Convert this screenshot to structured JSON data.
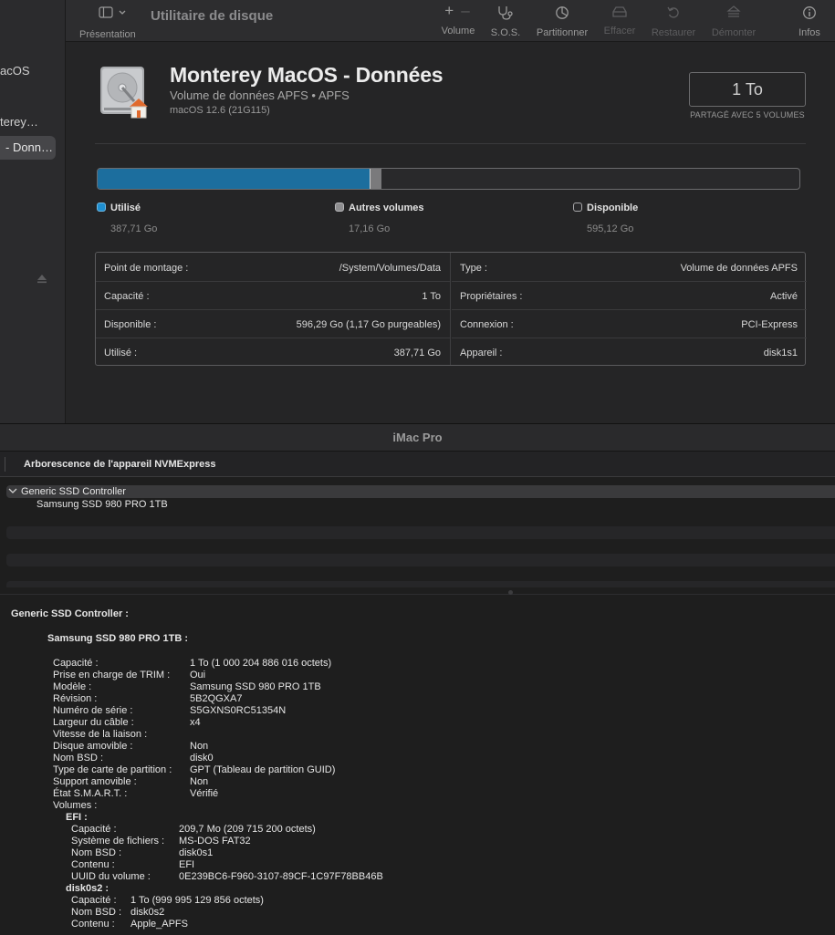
{
  "sidebar": {
    "items": [
      {
        "label": "acOS"
      },
      {
        "label": "terey…"
      },
      {
        "label": "- Donn…"
      }
    ]
  },
  "toolbar": {
    "presentation_label": "Présentation",
    "title": "Utilitaire de disque",
    "volume_label": "Volume",
    "sos_label": "S.O.S.",
    "partition_label": "Partitionner",
    "erase_label": "Effacer",
    "restore_label": "Restaurer",
    "unmount_label": "Démonter",
    "info_label": "Infos",
    "plus_symbol": "+",
    "minus_symbol": "–"
  },
  "volume": {
    "name": "Monterey MacOS - Données",
    "subtitle": "Volume de données APFS • APFS",
    "os": "macOS 12.6 (21G115)",
    "size": "1 To",
    "shared": "PARTAGÉ AVEC 5 VOLUMES"
  },
  "usage": {
    "used_fraction": 0.3877,
    "other_fraction": 0.0172,
    "colors": {
      "used": "#1c6e9e",
      "other": "#7a7a7c",
      "free": "#29292b"
    },
    "legend": [
      {
        "label": "Utilisé",
        "value": "387,71 Go",
        "color": "#1f8fd0"
      },
      {
        "label": "Autres volumes",
        "value": "17,16 Go",
        "color": "#8e8e90"
      },
      {
        "label": "Disponible",
        "value": "595,12 Go",
        "color": "#29292b"
      }
    ]
  },
  "info": {
    "left": [
      {
        "key": "Point de montage :",
        "value": "/System/Volumes/Data"
      },
      {
        "key": "Capacité :",
        "value": "1 To"
      },
      {
        "key": "Disponible :",
        "value": "596,29 Go (1,17 Go purgeables)"
      },
      {
        "key": "Utilisé :",
        "value": "387,71 Go"
      }
    ],
    "right": [
      {
        "key": "Type :",
        "value": "Volume de données APFS"
      },
      {
        "key": "Propriétaires :",
        "value": "Activé"
      },
      {
        "key": "Connexion :",
        "value": "PCI-Express"
      },
      {
        "key": "Appareil :",
        "value": "disk1s1"
      }
    ]
  },
  "sysinfo": {
    "window_title": "iMac Pro",
    "header": "Arborescence de l'appareil NVMExpress",
    "tree": [
      {
        "label": "Generic SSD Controller"
      },
      {
        "label": "Samsung SSD 980 PRO 1TB"
      }
    ],
    "controller_heading": "Generic SSD Controller :",
    "device_heading": "Samsung SSD 980 PRO 1TB :",
    "props": [
      {
        "key": "Capacité :",
        "value": "1 To (1 000 204 886 016 octets)"
      },
      {
        "key": "Prise en charge de TRIM :",
        "value": "Oui"
      },
      {
        "key": "Modèle :",
        "value": "Samsung SSD 980 PRO 1TB"
      },
      {
        "key": "Révision :",
        "value": "5B2QGXA7"
      },
      {
        "key": "Numéro de série :",
        "value": "S5GXNS0RC51354N"
      },
      {
        "key": "Largeur du câble :",
        "value": "x4"
      },
      {
        "key": "Vitesse de la liaison :",
        "value": ""
      },
      {
        "key": "Disque amovible :",
        "value": "Non"
      },
      {
        "key": "Nom BSD :",
        "value": "disk0"
      },
      {
        "key": "Type de carte de partition :",
        "value": "GPT (Tableau de partition GUID)"
      },
      {
        "key": "Support amovible :",
        "value": "Non"
      },
      {
        "key": "État S.M.A.R.T. :",
        "value": "Vérifié"
      }
    ],
    "volumes_label": "Volumes :",
    "efi": {
      "heading": "EFI :",
      "props": [
        {
          "key": "Capacité :",
          "value": "209,7 Mo (209 715 200 octets)"
        },
        {
          "key": "Système de fichiers :",
          "value": "MS-DOS FAT32"
        },
        {
          "key": "Nom BSD :",
          "value": "disk0s1"
        },
        {
          "key": "Contenu :",
          "value": "EFI"
        },
        {
          "key": "UUID du volume :",
          "value": "0E239BC6-F960-3107-89CF-1C97F78BB46B"
        }
      ]
    },
    "disk0s2": {
      "heading": "disk0s2 :",
      "props": [
        {
          "key": "Capacité :",
          "value": "1 To (999 995 129 856 octets)"
        },
        {
          "key": "Nom BSD :",
          "value": "disk0s2"
        },
        {
          "key": "Contenu :",
          "value": "Apple_APFS"
        }
      ]
    }
  }
}
